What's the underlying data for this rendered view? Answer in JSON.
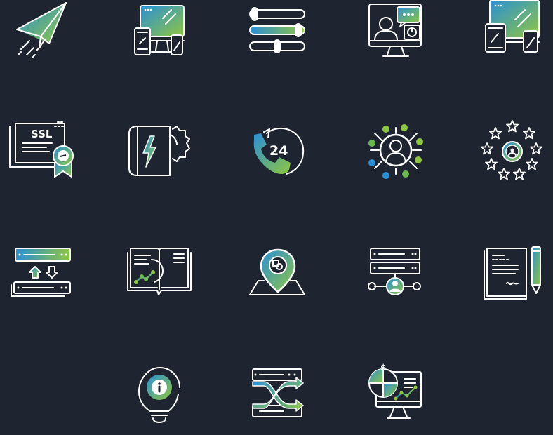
{
  "palette": {
    "background": "#1e2530",
    "line": "#ffffff",
    "grad_blue": "#2b8fd6",
    "grad_green": "#8ec63f"
  },
  "icons": [
    {
      "name": "paper-plane-icon"
    },
    {
      "name": "responsive-devices-icon"
    },
    {
      "name": "sliders-icon"
    },
    {
      "name": "video-chat-icon"
    },
    {
      "name": "multi-device-icon"
    },
    {
      "name": "ssl-certificate-icon",
      "text": "SSL"
    },
    {
      "name": "power-book-icon"
    },
    {
      "name": "support-24-icon",
      "text": "24"
    },
    {
      "name": "user-network-icon"
    },
    {
      "name": "star-rating-icon"
    },
    {
      "name": "data-transfer-icon"
    },
    {
      "name": "book-analytics-icon"
    },
    {
      "name": "location-pin-icon"
    },
    {
      "name": "server-user-icon"
    },
    {
      "name": "document-pen-icon"
    },
    {
      "name": "info-bulb-icon"
    },
    {
      "name": "shuffle-icon"
    },
    {
      "name": "finance-monitor-icon",
      "text": "$"
    }
  ]
}
